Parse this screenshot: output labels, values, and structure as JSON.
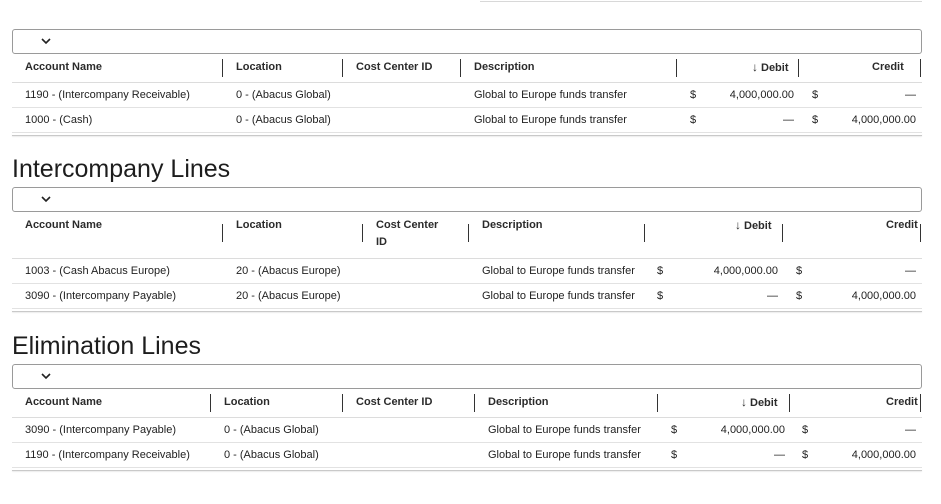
{
  "columns_default": {
    "account": "Account Name",
    "location": "Location",
    "cost_center": "Cost Center ID",
    "description": "Description",
    "debit": "Debit",
    "credit": "Credit"
  },
  "sections": [
    {
      "title": "",
      "rows": [
        {
          "account": "1190 - (Intercompany Receivable)",
          "location": "0 - (Abacus Global)",
          "cost_center": "",
          "description": "Global to Europe funds transfer",
          "debit_cur": "$",
          "debit": "4,000,000.00",
          "credit_cur": "$",
          "credit": "—"
        },
        {
          "account": "1000 - (Cash)",
          "location": "0 - (Abacus Global)",
          "cost_center": "",
          "description": "Global to Europe funds transfer",
          "debit_cur": "$",
          "debit": "—",
          "credit_cur": "$",
          "credit": "4,000,000.00"
        }
      ]
    },
    {
      "title": "Intercompany Lines",
      "cost_center_line1": "Cost Center",
      "cost_center_line2": "ID",
      "rows": [
        {
          "account": "1003 - (Cash Abacus Europe)",
          "location": "20 - (Abacus Europe)",
          "cost_center": "",
          "description": "Global to Europe funds transfer",
          "debit_cur": "$",
          "debit": "4,000,000.00",
          "credit_cur": "$",
          "credit": "—"
        },
        {
          "account": "3090 - (Intercompany Payable)",
          "location": "20 - (Abacus Europe)",
          "cost_center": "",
          "description": "Global to Europe funds transfer",
          "debit_cur": "$",
          "debit": "—",
          "credit_cur": "$",
          "credit": "4,000,000.00"
        }
      ]
    },
    {
      "title": "Elimination Lines",
      "rows": [
        {
          "account": "3090 - (Intercompany Payable)",
          "location": "0 - (Abacus Global)",
          "cost_center": "",
          "description": "Global to Europe funds transfer",
          "debit_cur": "$",
          "debit": "4,000,000.00",
          "credit_cur": "$",
          "credit": "—"
        },
        {
          "account": "1190 - (Intercompany Receivable)",
          "location": "0 - (Abacus Global)",
          "cost_center": "",
          "description": "Global to Europe funds transfer",
          "debit_cur": "$",
          "debit": "—",
          "credit_cur": "$",
          "credit": "4,000,000.00"
        }
      ]
    }
  ]
}
